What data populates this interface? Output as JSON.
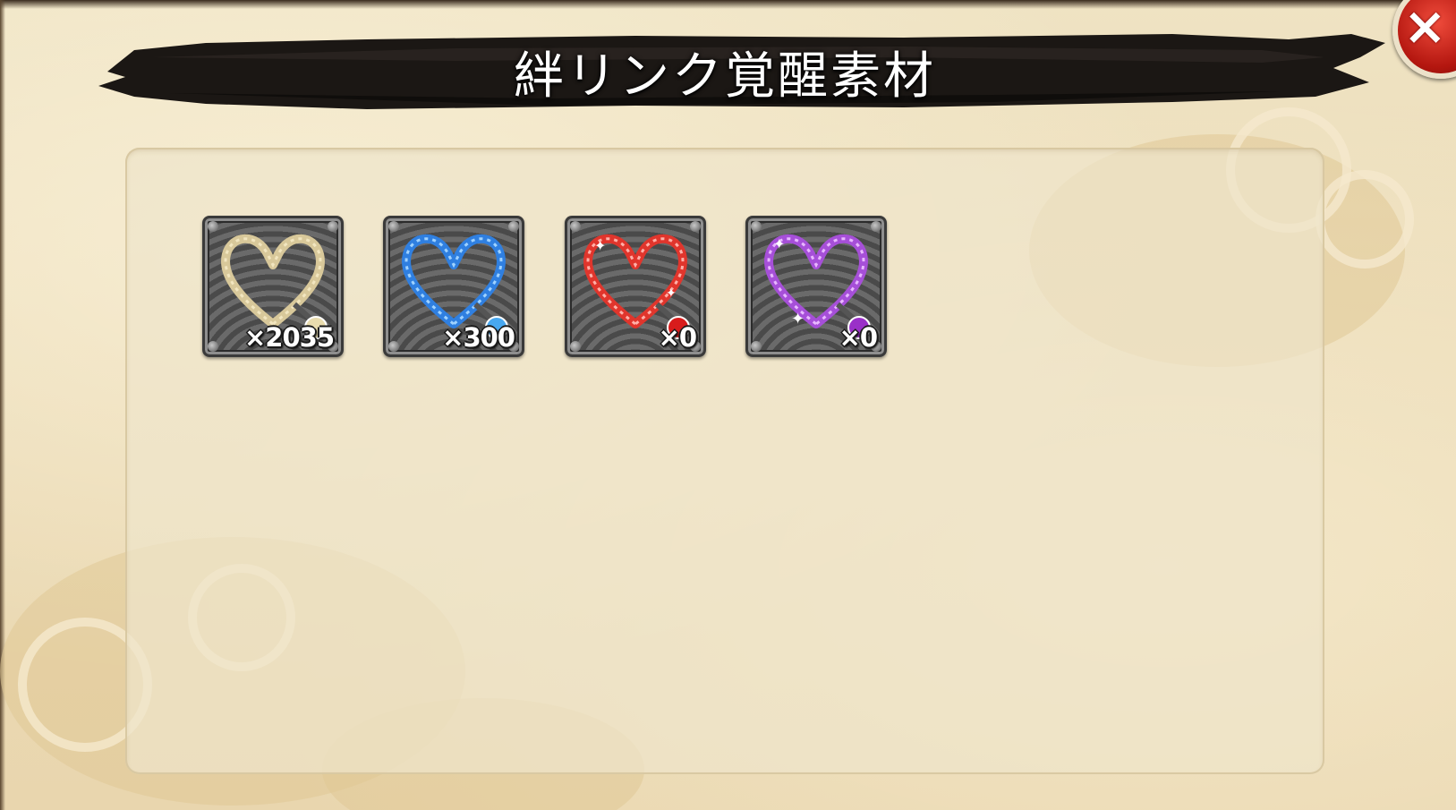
{
  "header": {
    "title": "絆リンク覚醒素材"
  },
  "close_button": {
    "icon": "close-icon",
    "label": "×",
    "color": "#d42a1c"
  },
  "items": [
    {
      "name": "gold-bond-rope",
      "color": "#d8c89a",
      "accent": "#f2e6c0",
      "charm": "#e9dcae",
      "quantity": "×2035"
    },
    {
      "name": "blue-bond-rope",
      "color": "#2f7fe0",
      "accent": "#9fd2ff",
      "charm": "#48a8f0",
      "quantity": "×300"
    },
    {
      "name": "red-bond-rope",
      "color": "#e0352c",
      "accent": "#ffb0a8",
      "charm": "#d81c1c",
      "quantity": "×0"
    },
    {
      "name": "purple-bond-rope",
      "color": "#a64fd8",
      "accent": "#e8b8ff",
      "charm": "#9a30c8",
      "quantity": "×0"
    }
  ]
}
